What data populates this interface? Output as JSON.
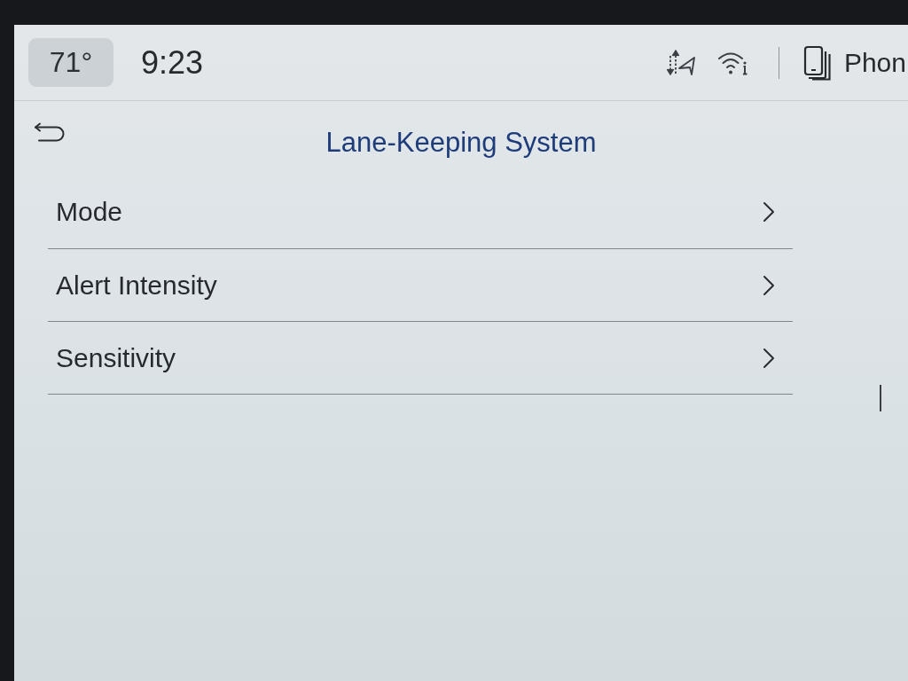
{
  "status_bar": {
    "temperature": "71°",
    "time": "9:23",
    "phone_label": "Phon"
  },
  "header": {
    "title": "Lane-Keeping System"
  },
  "menu": {
    "items": [
      {
        "label": "Mode"
      },
      {
        "label": "Alert Intensity"
      },
      {
        "label": "Sensitivity"
      }
    ]
  }
}
